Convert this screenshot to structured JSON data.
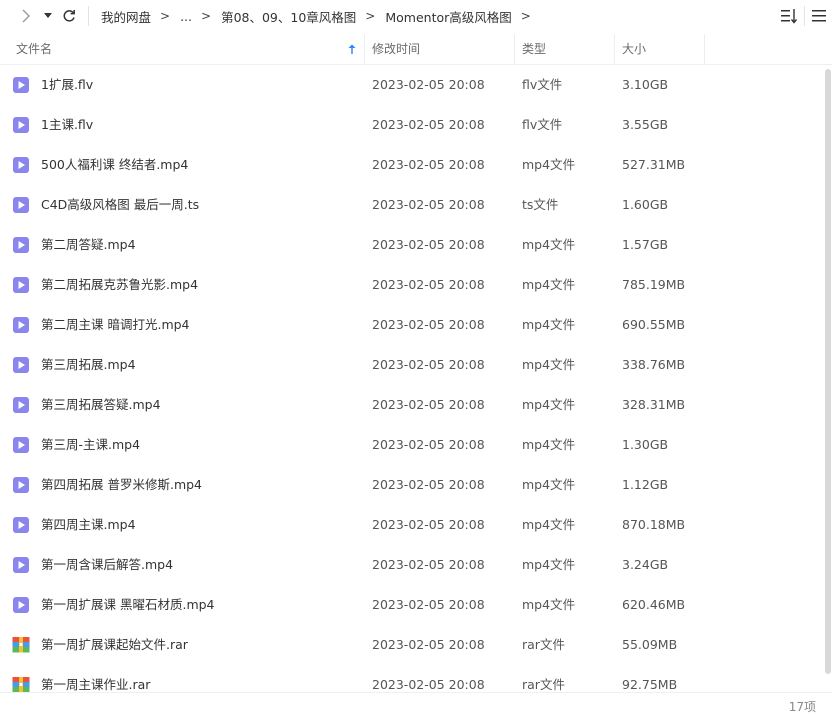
{
  "breadcrumb": {
    "root": "我的网盘",
    "ellipsis": "...",
    "parent": "第08、09、10章风格图",
    "current": "Momentor高级风格图",
    "separator": ">"
  },
  "columns": {
    "name": "文件名",
    "time": "修改时间",
    "type": "类型",
    "size": "大小"
  },
  "icons": {
    "video": "video-file-icon",
    "archive": "rar-archive-icon",
    "video_color": "#8b85ee",
    "accent": "#2a8bff"
  },
  "files": [
    {
      "name": "1扩展.flv",
      "time": "2023-02-05 20:08",
      "type": "flv文件",
      "size": "3.10GB",
      "icon": "video"
    },
    {
      "name": "1主课.flv",
      "time": "2023-02-05 20:08",
      "type": "flv文件",
      "size": "3.55GB",
      "icon": "video"
    },
    {
      "name": "500人福利课 终结者.mp4",
      "time": "2023-02-05 20:08",
      "type": "mp4文件",
      "size": "527.31MB",
      "icon": "video"
    },
    {
      "name": "C4D高级风格图 最后一周.ts",
      "time": "2023-02-05 20:08",
      "type": "ts文件",
      "size": "1.60GB",
      "icon": "video"
    },
    {
      "name": "第二周答疑.mp4",
      "time": "2023-02-05 20:08",
      "type": "mp4文件",
      "size": "1.57GB",
      "icon": "video"
    },
    {
      "name": "第二周拓展克苏鲁光影.mp4",
      "time": "2023-02-05 20:08",
      "type": "mp4文件",
      "size": "785.19MB",
      "icon": "video"
    },
    {
      "name": "第二周主课 暗调打光.mp4",
      "time": "2023-02-05 20:08",
      "type": "mp4文件",
      "size": "690.55MB",
      "icon": "video"
    },
    {
      "name": "第三周拓展.mp4",
      "time": "2023-02-05 20:08",
      "type": "mp4文件",
      "size": "338.76MB",
      "icon": "video"
    },
    {
      "name": "第三周拓展答疑.mp4",
      "time": "2023-02-05 20:08",
      "type": "mp4文件",
      "size": "328.31MB",
      "icon": "video"
    },
    {
      "name": "第三周-主课.mp4",
      "time": "2023-02-05 20:08",
      "type": "mp4文件",
      "size": "1.30GB",
      "icon": "video"
    },
    {
      "name": "第四周拓展 普罗米修斯.mp4",
      "time": "2023-02-05 20:08",
      "type": "mp4文件",
      "size": "1.12GB",
      "icon": "video"
    },
    {
      "name": "第四周主课.mp4",
      "time": "2023-02-05 20:08",
      "type": "mp4文件",
      "size": "870.18MB",
      "icon": "video"
    },
    {
      "name": "第一周含课后解答.mp4",
      "time": "2023-02-05 20:08",
      "type": "mp4文件",
      "size": "3.24GB",
      "icon": "video"
    },
    {
      "name": "第一周扩展课 黑曜石材质.mp4",
      "time": "2023-02-05 20:08",
      "type": "mp4文件",
      "size": "620.46MB",
      "icon": "video"
    },
    {
      "name": "第一周扩展课起始文件.rar",
      "time": "2023-02-05 20:08",
      "type": "rar文件",
      "size": "55.09MB",
      "icon": "archive"
    },
    {
      "name": "第一周主课作业.rar",
      "time": "2023-02-05 20:08",
      "type": "rar文件",
      "size": "92.75MB",
      "icon": "archive"
    }
  ],
  "status": {
    "count": "17项"
  }
}
